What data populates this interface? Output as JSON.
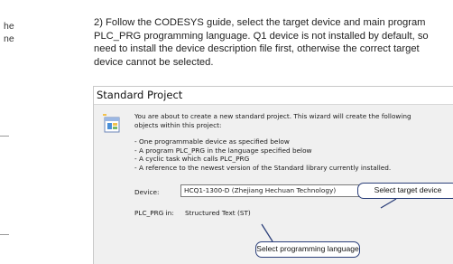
{
  "left_column": {
    "line1": "he",
    "line2": "ne"
  },
  "document": {
    "line1": "2) Follow the CODESYS guide, select the target device and main program",
    "line2": "PLC_PRG programming language. Q1 device is not installed by default, so",
    "line3": "need to install the device description file first, otherwise the correct target",
    "line4": "device cannot be selected."
  },
  "dialog": {
    "title": "Standard Project",
    "intro_line1": "You are about to create a new standard project. This wizard will create the following",
    "intro_line2": "objects within this project:",
    "bullets": [
      "- One programmable device as specified below",
      "- A program PLC_PRG in the language specified below",
      "- A cyclic task which calls PLC_PRG",
      "- A reference to the newest version of the Standard library currently installed."
    ],
    "device_label": "Device:",
    "device_value": "HCQ1-1300-D (Zhejiang Hechuan Technology)",
    "plc_prg_label": "PLC_PRG in:",
    "plc_prg_value": "Structured Text (ST)",
    "icon": "wizard-project-icon"
  },
  "callouts": {
    "target_device": "Select target device",
    "programming_language": "Select programming language",
    "border_color": "#2b3f7a"
  }
}
